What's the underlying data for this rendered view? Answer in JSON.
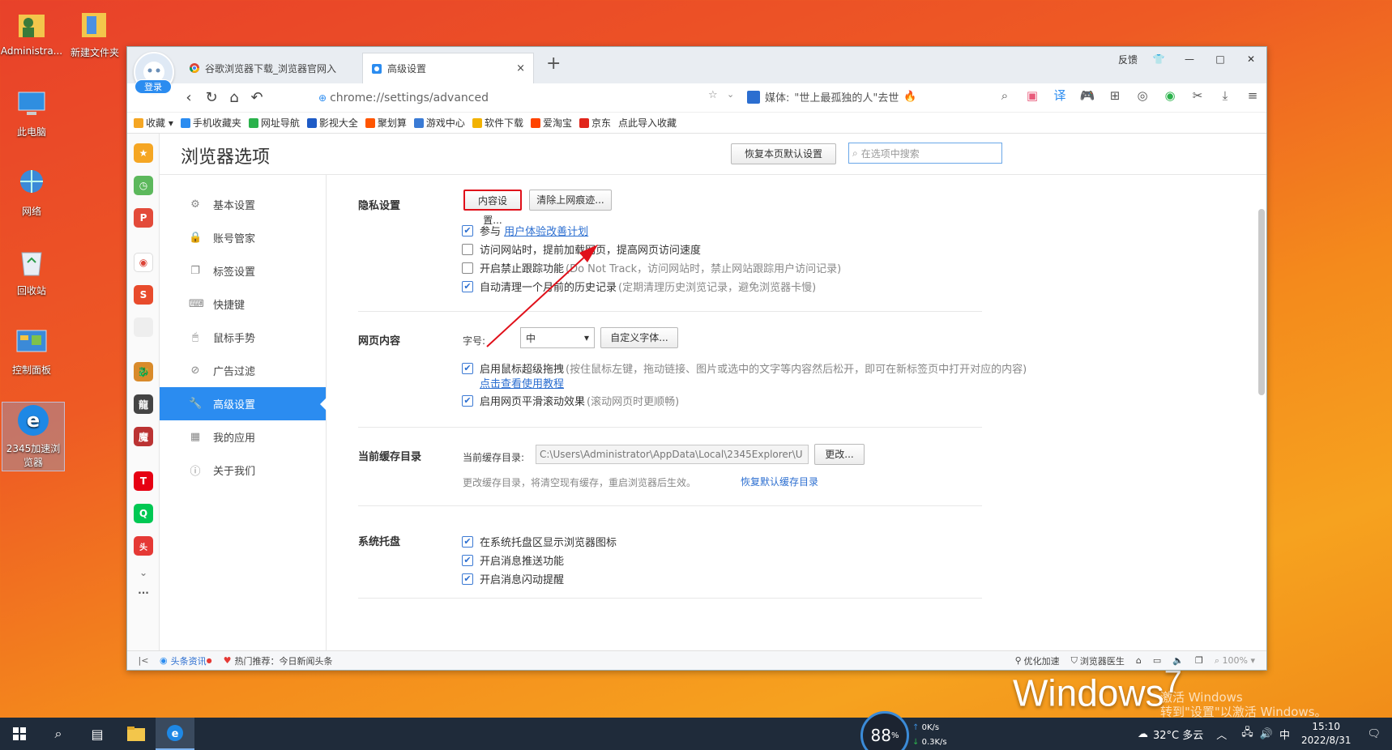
{
  "desktop": {
    "icons": [
      {
        "label": "Administra...",
        "icon": "user-folder-icon"
      },
      {
        "label": "新建文件夹",
        "icon": "folder-icon"
      },
      {
        "label": "此电脑",
        "icon": "computer-icon"
      },
      {
        "label": "网络",
        "icon": "network-icon"
      },
      {
        "label": "回收站",
        "icon": "recycle-bin-icon"
      },
      {
        "label": "控制面板",
        "icon": "control-panel-icon"
      },
      {
        "label": "2345加速浏览器",
        "icon": "browser-icon"
      }
    ],
    "win7_logo": "Windows",
    "win7_sup": "7",
    "watermark": [
      "激活 Windows",
      "转到\"设置\"以激活 Windows。"
    ]
  },
  "browser": {
    "login_label": "登录",
    "tabs": [
      {
        "title": "谷歌浏览器下载_浏览器官网入",
        "icon": "chrome-icon"
      },
      {
        "title": "高级设置",
        "icon": "settings-icon",
        "close": "×"
      }
    ],
    "new_tab": "+",
    "window_controls": {
      "feedback": "反馈",
      "skin": "skin-icon",
      "minimize": "—",
      "maximize": "□",
      "close": "✕"
    },
    "address": "chrome://settings/advanced",
    "media_label": "媒体:",
    "media_text": "\"世上最孤独的人\"去世",
    "bookmarks": [
      {
        "label": "收藏",
        "color": "#f5a623"
      },
      {
        "label": "手机收藏夹",
        "color": "#2b8cf0"
      },
      {
        "label": "网址导航",
        "color": "#2bb24c"
      },
      {
        "label": "影视大全",
        "color": "#1e5bc6"
      },
      {
        "label": "聚划算",
        "color": "#ff5500"
      },
      {
        "label": "游戏中心",
        "color": "#3a7bd5"
      },
      {
        "label": "软件下载",
        "color": "#f2b200"
      },
      {
        "label": "爱淘宝",
        "color": "#ff4400"
      },
      {
        "label": "京东",
        "color": "#e1251b"
      },
      {
        "label": "点此导入收藏",
        "color": ""
      }
    ]
  },
  "settings": {
    "title": "浏览器选项",
    "restore_default": "恢复本页默认设置",
    "search_placeholder": "在选项中搜索",
    "menu": [
      {
        "label": "基本设置",
        "icon": "gear-icon",
        "glyph": "⚙"
      },
      {
        "label": "账号管家",
        "icon": "lock-icon",
        "glyph": "🔒"
      },
      {
        "label": "标签设置",
        "icon": "tabs-icon",
        "glyph": "❐"
      },
      {
        "label": "快捷键",
        "icon": "keyboard-icon",
        "glyph": "⌨"
      },
      {
        "label": "鼠标手势",
        "icon": "mouse-icon",
        "glyph": "🖱"
      },
      {
        "label": "广告过滤",
        "icon": "block-icon",
        "glyph": "⊘"
      },
      {
        "label": "高级设置",
        "icon": "wrench-icon",
        "glyph": "🔧"
      },
      {
        "label": "我的应用",
        "icon": "apps-icon",
        "glyph": "▦"
      },
      {
        "label": "关于我们",
        "icon": "info-icon",
        "glyph": "ⓘ"
      }
    ],
    "privacy": {
      "title": "隐私设置",
      "content_settings": "内容设置...",
      "clear_history": "清除上网痕迹...",
      "opt1_prefix": "参与",
      "opt1_link": "用户体验改善计划",
      "opt2": "访问网站时，提前加载网页，提高网页访问速度",
      "opt3": "开启禁止跟踪功能",
      "opt3_hint": "(Do Not Track，访问网站时，禁止网站跟踪用户访问记录)",
      "opt4": "自动清理一个月前的历史记录",
      "opt4_hint": "(定期清理历史浏览记录，避免浏览器卡慢)"
    },
    "webcontent": {
      "title": "网页内容",
      "font_label": "字号:",
      "font_value": "中",
      "custom_font": "自定义字体...",
      "opt1": "启用鼠标超级拖拽",
      "opt1_hint": "(按住鼠标左键，拖动链接、图片或选中的文字等内容然后松开，即可在新标签页中打开对应的内容)",
      "opt1_link": "点击查看使用教程",
      "opt2": "启用网页平滑滚动效果",
      "opt2_hint": "(滚动网页时更顺畅)"
    },
    "cache": {
      "title": "当前缓存目录",
      "label": "当前缓存目录:",
      "path": "C:\\Users\\Administrator\\AppData\\Local\\2345Explorer\\U",
      "change": "更改...",
      "note": "更改缓存目录，将清空现有缓存，重启浏览器后生效。",
      "restore_link": "恢复默认缓存目录"
    },
    "tray": {
      "title": "系统托盘",
      "opt1": "在系统托盘区显示浏览器图标",
      "opt2": "开启消息推送功能",
      "opt3": "开启消息闪动提醒"
    }
  },
  "statusbar": {
    "news": "头条资讯",
    "hot": "热门推荐：今日新闻头条",
    "optimize": "优化加速",
    "doctor": "浏览器医生",
    "zoom": "100%"
  },
  "taskbar": {
    "gauge": "88",
    "gauge_unit": "%",
    "up": "0K/s",
    "down": "0.3K/s",
    "weather": "32°C 多云",
    "ime": "中",
    "time": "15:10",
    "date": "2022/8/31"
  }
}
